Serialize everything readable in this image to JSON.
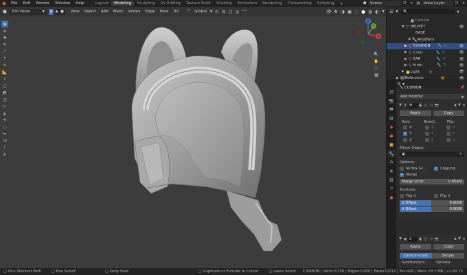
{
  "topbar": {
    "menus": [
      "File",
      "Edit",
      "Render",
      "Window",
      "Help"
    ],
    "workspaces": [
      "Layout",
      "Modeling",
      "Sculpting",
      "UV Editing",
      "Texture Paint",
      "Shading",
      "Animation",
      "Rendering",
      "Compositing",
      "Scripting"
    ],
    "active_workspace": "Modeling",
    "add_tab": "+",
    "scene": "Scene",
    "view_layer": "View Layer"
  },
  "viewport": {
    "mode": "Edit Mode",
    "menus": [
      "View",
      "Select",
      "Add",
      "Mesh",
      "Vertex",
      "Edge",
      "Face",
      "UV"
    ],
    "transform_orientation": "Global",
    "gizmo": {
      "x": "X",
      "y": "Y",
      "z": "Z"
    }
  },
  "outliner": {
    "rows": [
      {
        "label": "Camera",
        "indent": 3,
        "selected": false
      },
      {
        "label": "HELMET",
        "indent": 2,
        "selected": false
      },
      {
        "label": "BASE",
        "indent": 3,
        "selected": false
      },
      {
        "label": "Modifiers",
        "indent": 3,
        "selected": false
      },
      {
        "label": "CUSHION",
        "indent": 3,
        "selected": true
      },
      {
        "label": "Crest",
        "indent": 3,
        "selected": false
      },
      {
        "label": "EAR",
        "indent": 3,
        "selected": false
      },
      {
        "label": "Inner",
        "indent": 3,
        "selected": false
      },
      {
        "label": "Light",
        "indent": 2,
        "selected": false
      },
      {
        "label": "Reference",
        "indent": 1,
        "selected": false
      }
    ]
  },
  "properties": {
    "object_name": "CUSHION",
    "add_modifier": "Add Modifier",
    "mirror": {
      "short_name": "M",
      "apply": "Apply",
      "copy": "Copy",
      "axis_label": "Axis:",
      "bisect_label": "Bisect:",
      "flip_label": "Flip:",
      "axes": [
        "X",
        "Y",
        "Z"
      ],
      "axis_checked": [
        false,
        true,
        false
      ],
      "mirror_object_label": "Mirror Object:",
      "options_label": "Options:",
      "vertex_groups": "Vertex Gr..",
      "clipping": "Clipping",
      "merge": "Merge",
      "merge_limit_label": "Merge Limit:",
      "merge_limit_value": "0.054m",
      "textures_label": "Textures:",
      "flip_u": "Flip U",
      "flip_v": "Flip V",
      "u_offset_label": "U Offset:",
      "u_offset_value": "0.0000",
      "v_offset_label": "V Offset:",
      "v_offset_value": "0.0000"
    },
    "subsurf": {
      "short_name": "S",
      "apply": "Apply",
      "copy": "Copy",
      "catmull": "Catmull-Clark",
      "simple": "Simple",
      "subdivisions_label": "Subdivisions:",
      "options_label": "Options:"
    }
  },
  "statusbar": {
    "left": [
      "Pick Shortest Path",
      "Box Select",
      "Dolly View",
      "Duplicate or Extrude to Cursor",
      "Lasso Select"
    ],
    "stats": "CUSHION | Verts:2/238 | Edges:1/450 | Faces:0/213 | Tris:428 | Mem: 63.3 MB | v2.80.75"
  }
}
